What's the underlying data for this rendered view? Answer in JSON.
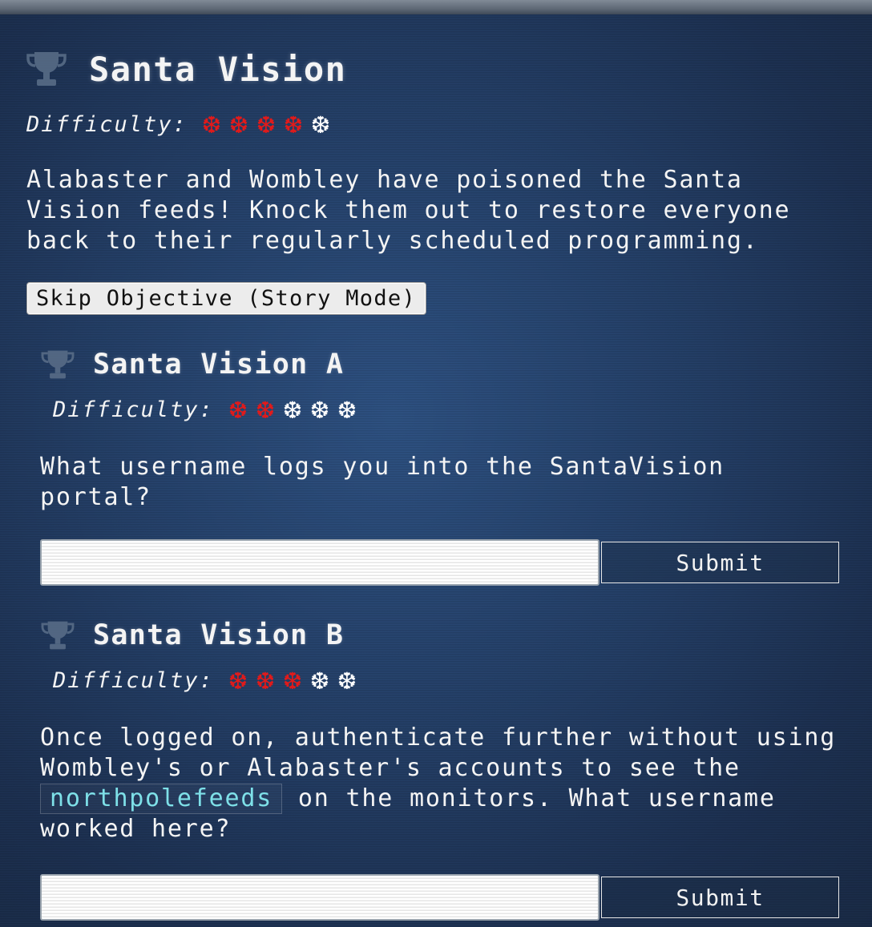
{
  "objective": {
    "title": "Santa Vision",
    "difficulty_label": "Difficulty:",
    "difficulty": {
      "filled": 4,
      "total": 5
    },
    "description": "Alabaster and Wombley have poisoned the Santa Vision feeds! Knock them out to restore everyone back to their regularly scheduled programming.",
    "skip_label": "Skip Objective (Story Mode)"
  },
  "subobjectives": [
    {
      "title": "Santa Vision A",
      "difficulty_label": "Difficulty:",
      "difficulty": {
        "filled": 2,
        "total": 5
      },
      "question": "What username logs you into the SantaVision portal?",
      "submit_label": "Submit",
      "input_value": ""
    },
    {
      "title": "Santa Vision B",
      "difficulty_label": "Difficulty:",
      "difficulty": {
        "filled": 3,
        "total": 5
      },
      "question_line1": "Once logged on, authenticate further without using",
      "question_line2": "Wombley's or Alabaster's accounts to see the",
      "question_code": "northpolefeeds",
      "question_after_code": " on the monitors. What username",
      "question_line4": "worked here?",
      "submit_label": "Submit",
      "input_value": ""
    }
  ],
  "colors": {
    "difficulty_on": "#e21a1a",
    "difficulty_off": "#ffffff",
    "code_text": "#7ee0e8",
    "trophy": "#5b6f89"
  },
  "icons": {
    "trophy": "trophy-icon",
    "difficulty": "snowflake-icon"
  }
}
